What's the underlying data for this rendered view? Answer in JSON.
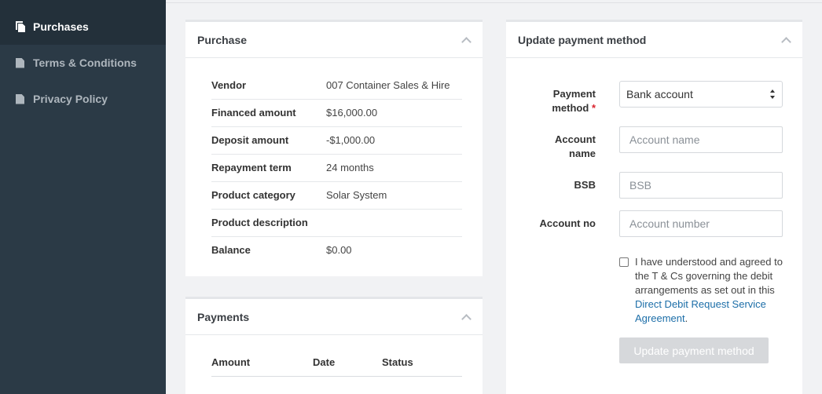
{
  "sidebar": {
    "items": [
      {
        "label": "Purchases",
        "icon": "copy-icon",
        "active": true
      },
      {
        "label": "Terms & Conditions",
        "icon": "document-icon",
        "active": false
      },
      {
        "label": "Privacy Policy",
        "icon": "document-icon",
        "active": false
      }
    ]
  },
  "purchase": {
    "title": "Purchase",
    "rows": [
      {
        "label": "Vendor",
        "value": "007 Container Sales & Hire"
      },
      {
        "label": "Financed amount",
        "value": "$16,000.00"
      },
      {
        "label": "Deposit amount",
        "value": "-$1,000.00"
      },
      {
        "label": "Repayment term",
        "value": "24 months"
      },
      {
        "label": "Product category",
        "value": "Solar System"
      },
      {
        "label": "Product description",
        "value": ""
      },
      {
        "label": "Balance",
        "value": "$0.00"
      }
    ]
  },
  "payments": {
    "title": "Payments",
    "columns": [
      "Amount",
      "Date",
      "Status"
    ]
  },
  "update_payment": {
    "title": "Update payment method",
    "payment_method_label_1": "Payment",
    "payment_method_label_2": "method",
    "required_mark": "*",
    "payment_method_value": "Bank account",
    "account_name_label_1": "Account",
    "account_name_label_2": "name",
    "account_name_placeholder": "Account name",
    "bsb_label": "BSB",
    "bsb_placeholder": "BSB",
    "account_no_label": "Account no",
    "account_no_placeholder": "Account number",
    "agreement_text": "I have understood and agreed to the T & Cs governing the debit arrangements as set out in this ",
    "agreement_link": "Direct Debit Request Service Agreement",
    "agreement_end": ".",
    "submit_label": "Update payment method"
  }
}
